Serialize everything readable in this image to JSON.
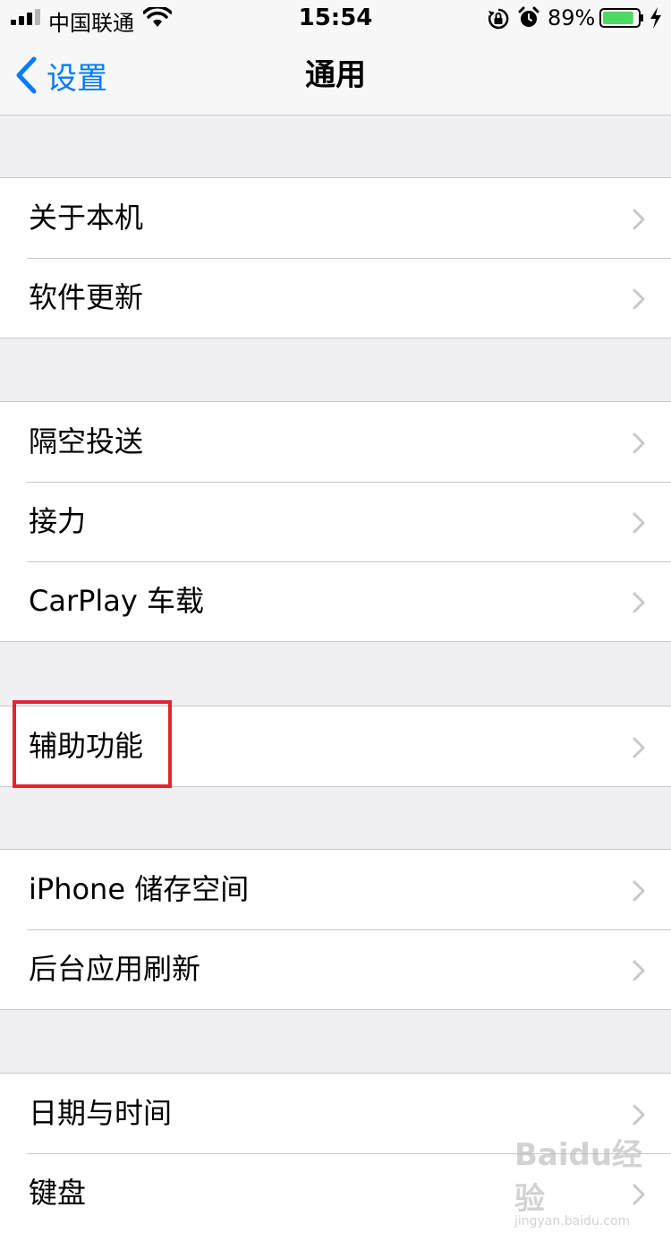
{
  "status_bar": {
    "carrier": "中国联通",
    "time": "15:54",
    "battery_percent": "89%",
    "battery_level": 0.89,
    "battery_color": "#4cd964"
  },
  "nav": {
    "back_label": "设置",
    "title": "通用",
    "accent_color": "#007aff"
  },
  "groups": [
    [
      "关于本机",
      "软件更新"
    ],
    [
      "隔空投送",
      "接力",
      "CarPlay 车载"
    ],
    [
      "辅助功能"
    ],
    [
      "iPhone 储存空间",
      "后台应用刷新"
    ],
    [
      "日期与时间",
      "键盘"
    ]
  ],
  "icons": {
    "back": "chevron-left-icon",
    "row": "chevron-right-icon"
  },
  "highlight_color": "#e0252e",
  "watermark": {
    "logo": "Baidu经验",
    "url": "jingyan.baidu.com"
  }
}
